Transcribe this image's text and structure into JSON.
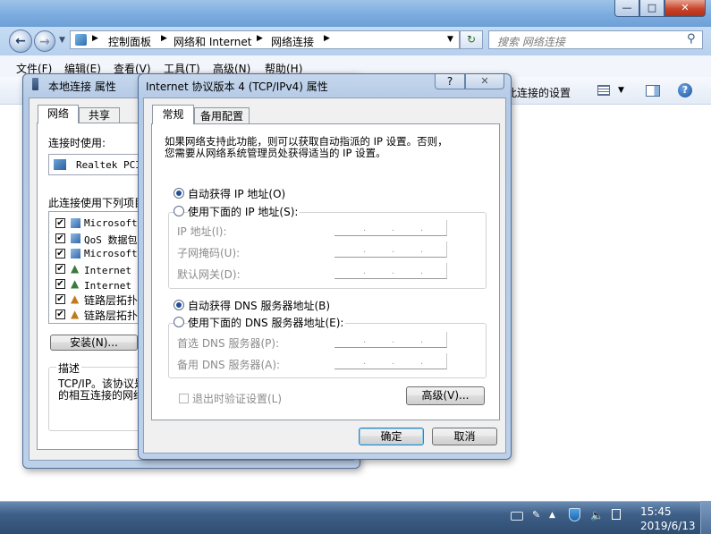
{
  "explorer": {
    "window_controls": {
      "minimize": "—",
      "maximize": "□",
      "close": "✕"
    },
    "address": {
      "crumbs": [
        "控制面板",
        "网络和 Internet",
        "网络连接"
      ]
    },
    "search_placeholder": "搜索 网络连接",
    "menu": [
      "文件(F)",
      "编辑(E)",
      "查看(V)",
      "工具(T)",
      "高级(N)",
      "帮助(H)"
    ],
    "command_text": "此连接的设置"
  },
  "local_dialog": {
    "title": "本地连接 属性",
    "tabs": [
      "网络",
      "共享"
    ],
    "connect_using_label": "连接时使用:",
    "adapter": "Realtek PCIe",
    "items_label": "此连接使用下列项目",
    "items": [
      {
        "label": "Microsoft",
        "checked": true
      },
      {
        "label": "QoS 数据包",
        "checked": true
      },
      {
        "label": "Microsoft",
        "checked": true
      },
      {
        "label": "Internet 协",
        "checked": true
      },
      {
        "label": "Internet 协",
        "checked": true
      },
      {
        "label": "链路层拓扑",
        "checked": true
      },
      {
        "label": "链路层拓扑",
        "checked": true
      }
    ],
    "install_button": "安装(N)...",
    "description_label": "描述",
    "description_text_1": "TCP/IP。该协议是",
    "description_text_2": "的相互连接的网络"
  },
  "ipv4_dialog": {
    "title": "Internet 协议版本 4 (TCP/IPv4) 属性",
    "help_button": "?",
    "close_button": "✕",
    "tabs": [
      "常规",
      "备用配置"
    ],
    "intro_1": "如果网络支持此功能，则可以获取自动指派的 IP 设置。否则，",
    "intro_2": "您需要从网络系统管理员处获得适当的 IP 设置。",
    "auto_ip": "自动获得 IP 地址(O)",
    "manual_ip": "使用下面的 IP 地址(S):",
    "ip_fields": [
      "IP 地址(I):",
      "子网掩码(U):",
      "默认网关(D):"
    ],
    "auto_dns": "自动获得 DNS 服务器地址(B)",
    "manual_dns": "使用下面的 DNS 服务器地址(E):",
    "dns_fields": [
      "首选 DNS 服务器(P):",
      "备用 DNS 服务器(A):"
    ],
    "validate_on_exit": "退出时验证设置(L)",
    "advanced_button": "高级(V)...",
    "ok_button": "确定",
    "cancel_button": "取消",
    "ip_mode": "auto",
    "dns_mode": "auto"
  },
  "taskbar": {
    "time": "15:45",
    "date": "2019/6/13"
  },
  "colors": {
    "titlebar": "#7eaee0",
    "close_red": "#c8442a",
    "desktop_blue": "#3e79bf"
  }
}
